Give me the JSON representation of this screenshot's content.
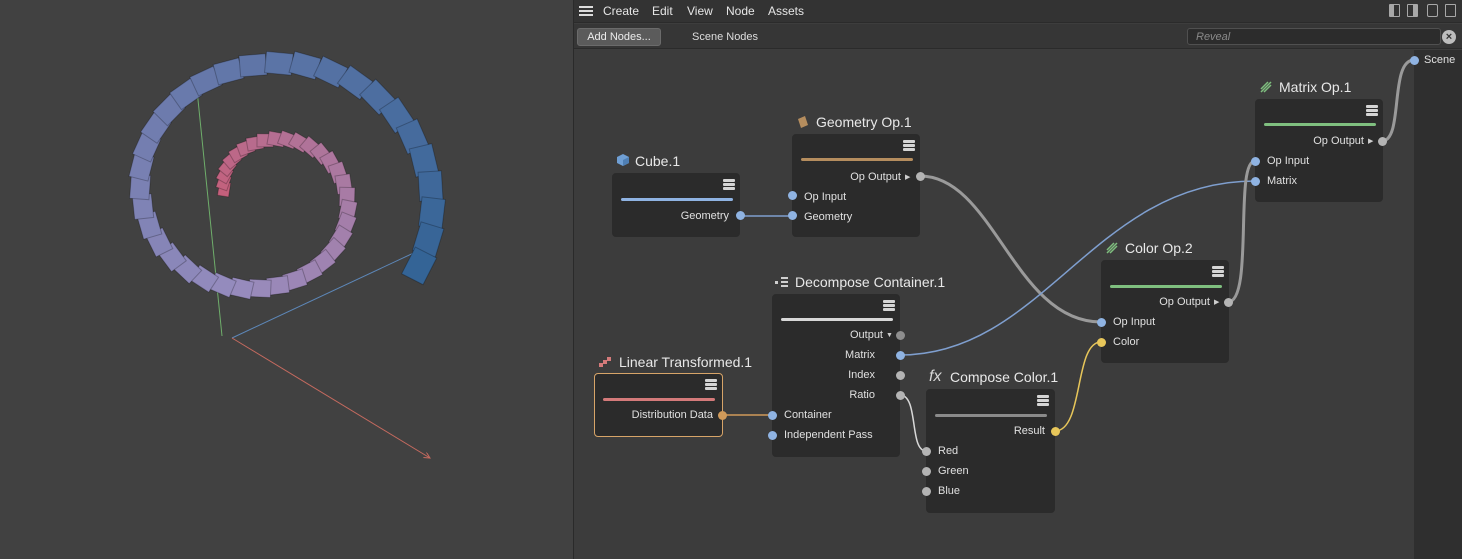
{
  "menu": {
    "items": [
      "Create",
      "Edit",
      "View",
      "Node",
      "Assets"
    ]
  },
  "toolbar": {
    "add_nodes_label": "Add Nodes...",
    "scene_nodes_tab": "Scene Nodes",
    "reveal_placeholder": "Reveal"
  },
  "nodes": {
    "cube": {
      "title": "Cube.1",
      "ports": [
        "Geometry"
      ],
      "bar_color": "#8fb3e2"
    },
    "geometry_op": {
      "title": "Geometry Op.1",
      "ports": [
        "Op Output",
        "Op Input",
        "Geometry"
      ],
      "bar_color": "#b58d5e"
    },
    "decompose": {
      "title": "Decompose Container.1",
      "ports": [
        "Output",
        "Matrix",
        "Index",
        "Ratio",
        "Container",
        "Independent Pass"
      ],
      "bar_color": "#d8d8d8"
    },
    "linear_transformed": {
      "title": "Linear Transformed.1",
      "ports": [
        "Distribution Data"
      ],
      "bar_color": "#d47a7a"
    },
    "compose_color": {
      "title": "Compose Color.1",
      "ports": [
        "Result",
        "Red",
        "Green",
        "Blue"
      ],
      "bar_color": "#8a8a8a"
    },
    "color_op": {
      "title": "Color Op.2",
      "ports": [
        "Op Output",
        "Op Input",
        "Color"
      ],
      "bar_color": "#7fbf7f"
    },
    "matrix_op": {
      "title": "Matrix Op.1",
      "ports": [
        "Op Output",
        "Op Input",
        "Matrix"
      ],
      "bar_color": "#7fbf7f"
    },
    "scene": {
      "title": "Scene"
    }
  },
  "colors": {
    "selected_border": "#d7a468",
    "port_blue": "#8fb3e2",
    "port_yellow": "#e7c65a",
    "wire_gray": "#9a9a9a",
    "wire_blue": "#7f9fcf"
  },
  "icons": [
    "hamburger-menu-icon",
    "cube-icon",
    "geometry-op-icon",
    "decompose-icon",
    "linear-transformed-icon",
    "fx-icon",
    "color-op-icon",
    "matrix-op-icon",
    "node-menu-icon",
    "clear-icon"
  ]
}
